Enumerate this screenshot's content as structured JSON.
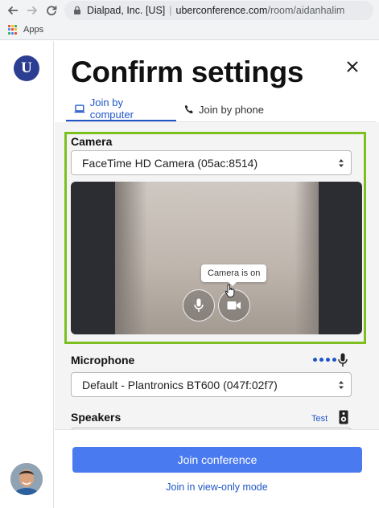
{
  "browser": {
    "site_name": "Dialpad, Inc. [US]",
    "url_host": "uberconference.com",
    "url_path": "/room/aidanhalim",
    "bookmark_apps": "Apps"
  },
  "sidebar": {
    "logo_letter": "U"
  },
  "dialog": {
    "title": "Confirm settings",
    "tabs": [
      {
        "label": "Join by computer",
        "icon": "laptop-icon",
        "active": true
      },
      {
        "label": "Join by phone",
        "icon": "phone-icon",
        "active": false
      }
    ],
    "camera": {
      "label": "Camera",
      "selected": "FaceTime HD Camera (05ac:8514)",
      "tooltip": "Camera is on"
    },
    "microphone": {
      "label": "Microphone",
      "selected": "Default - Plantronics BT600 (047f:02f7)"
    },
    "speakers": {
      "label": "Speakers",
      "test_label": "Test"
    },
    "join_button": "Join conference",
    "view_only_link": "Join in view-only mode"
  },
  "colors": {
    "accent": "#1f55c8",
    "join_button": "#4a7af0",
    "highlight_border": "#7cc020",
    "logo_bg": "#2c3e91"
  }
}
